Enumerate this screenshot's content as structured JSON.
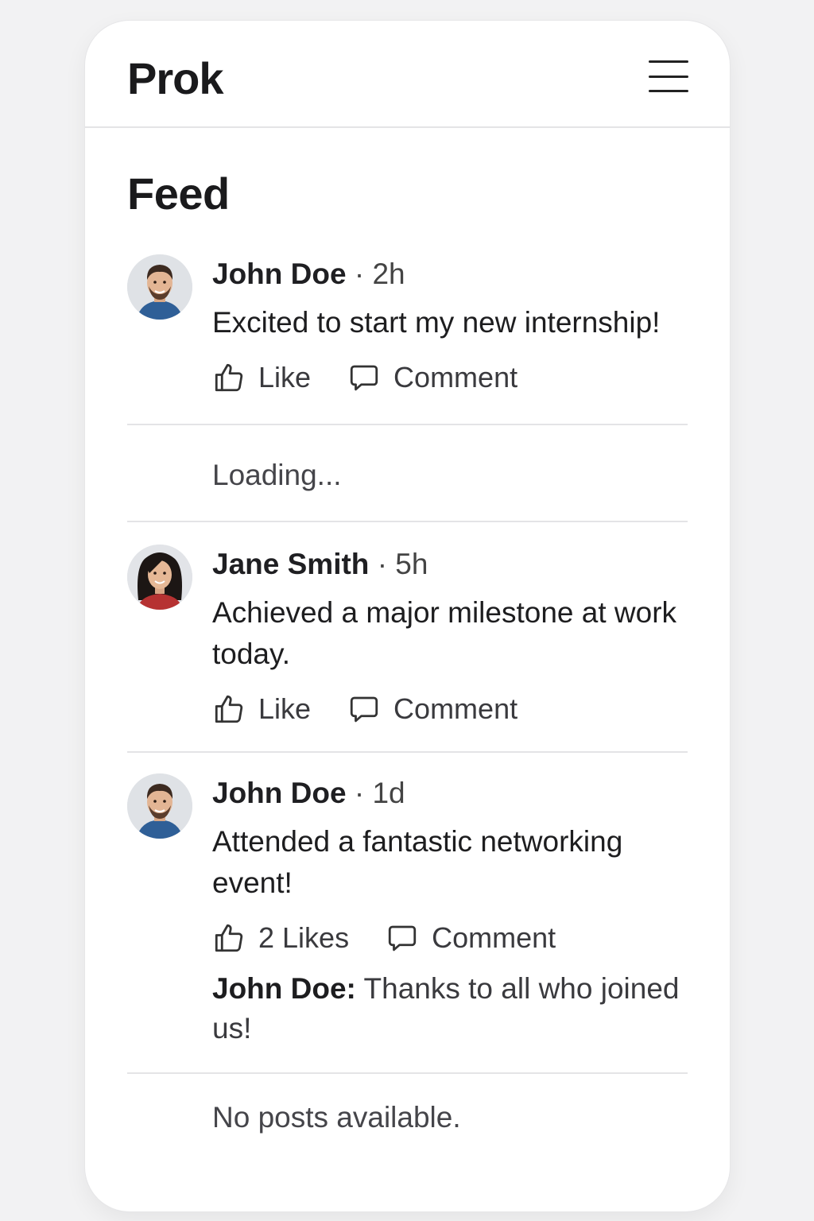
{
  "app": {
    "title": "Prok",
    "menu_icon": "hamburger-menu-icon"
  },
  "feed": {
    "title": "Feed",
    "loading_text": "Loading...",
    "empty_text": "No posts available.",
    "posts": [
      {
        "author": "John Doe",
        "separator": "·",
        "time": "2h",
        "text": "Excited to start my new internship!",
        "like_label": "Like",
        "comment_label": "Comment"
      },
      {
        "author": "Jane Smith",
        "separator": "·",
        "time": "5h",
        "text": "Achieved a major milestone at work today.",
        "like_label": "Like",
        "comment_label": "Comment"
      },
      {
        "author": "John Doe",
        "separator": "·",
        "time": "1d",
        "text": "Attended a fantastic networking event!",
        "like_label": "2 Likes",
        "comment_label": "Comment",
        "comment": {
          "author": "John Doe:",
          "text": "Thanks to all who joined us!"
        }
      }
    ]
  },
  "colors": {
    "background": "#f2f2f3",
    "card": "#ffffff",
    "divider": "#e4e4e6",
    "text": "#1d1d1f"
  },
  "icons": {
    "like": "thumbs-up-icon",
    "comment": "speech-bubble-icon"
  }
}
